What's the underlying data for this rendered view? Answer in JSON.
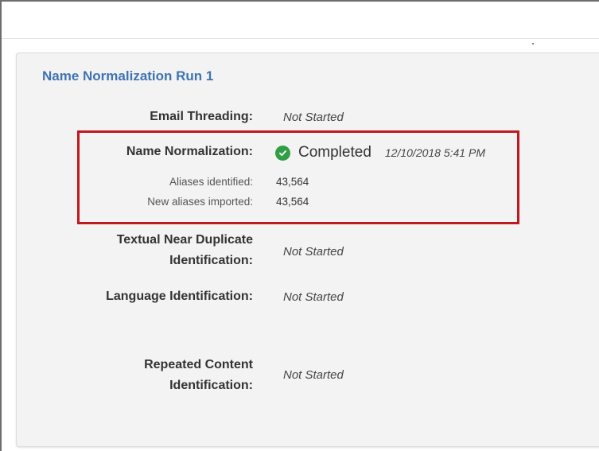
{
  "card": {
    "title": "Name Normalization Run 1"
  },
  "rows": {
    "email_threading": {
      "label": "Email Threading:",
      "status": "Not Started"
    },
    "name_normalization": {
      "label": "Name Normalization:",
      "status": "Completed",
      "timestamp": "12/10/2018 5:41 PM",
      "aliases_identified_label": "Aliases identified:",
      "aliases_identified_value": "43,564",
      "new_aliases_label": "New aliases imported:",
      "new_aliases_value": "43,564"
    },
    "textual_near_duplicate": {
      "label_line1": "Textual Near Duplicate",
      "label_line2": "Identification:",
      "status": "Not Started"
    },
    "language_identification": {
      "label": "Language Identification:",
      "status": "Not Started"
    },
    "repeated_content": {
      "label_line1": "Repeated Content",
      "label_line2": "Identification:",
      "status": "Not Started"
    }
  },
  "icons": {
    "completed": "check-circle-icon"
  },
  "colors": {
    "title": "#3f73b5",
    "highlight_border": "#c0181e",
    "success": "#2f9e44",
    "card_background": "#f3f3f3"
  }
}
